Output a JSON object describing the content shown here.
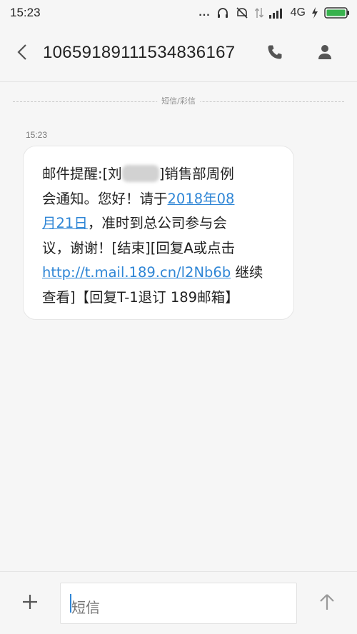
{
  "status_bar": {
    "time": "15:23",
    "dots": "...",
    "network": "4G",
    "icons": [
      "headphones-icon",
      "mute-icon",
      "data-arrows-icon",
      "signal-icon",
      "charging-icon",
      "battery-icon"
    ]
  },
  "header": {
    "title": "10659189111534836167",
    "icons": [
      "back-icon",
      "phone-icon",
      "contact-icon"
    ]
  },
  "conversation": {
    "divider_label": "短信/彩信",
    "message": {
      "time": "15:23",
      "line1_a": "邮件提醒:[刘",
      "line1_b": "]销售部周例",
      "line2_a": "会通知。您好！请于",
      "line2_link": "2018年08",
      "line3_link": "月21日",
      "line3_b": "，准时到总公司参与会",
      "line4": "议，谢谢！[结束][回复A或点击",
      "line5_link": "http://t.mail.189.cn/l2Nb6b",
      "line5_b": " 继续",
      "line6": "查看]【回复T-1退订 189邮箱】"
    }
  },
  "composer": {
    "placeholder": "短信",
    "icons": [
      "add-icon",
      "send-arrow-icon"
    ]
  },
  "colors": {
    "background": "#f6f6f6",
    "bubble": "#ffffff",
    "link": "#2f86d6",
    "battery": "#37b24d"
  }
}
